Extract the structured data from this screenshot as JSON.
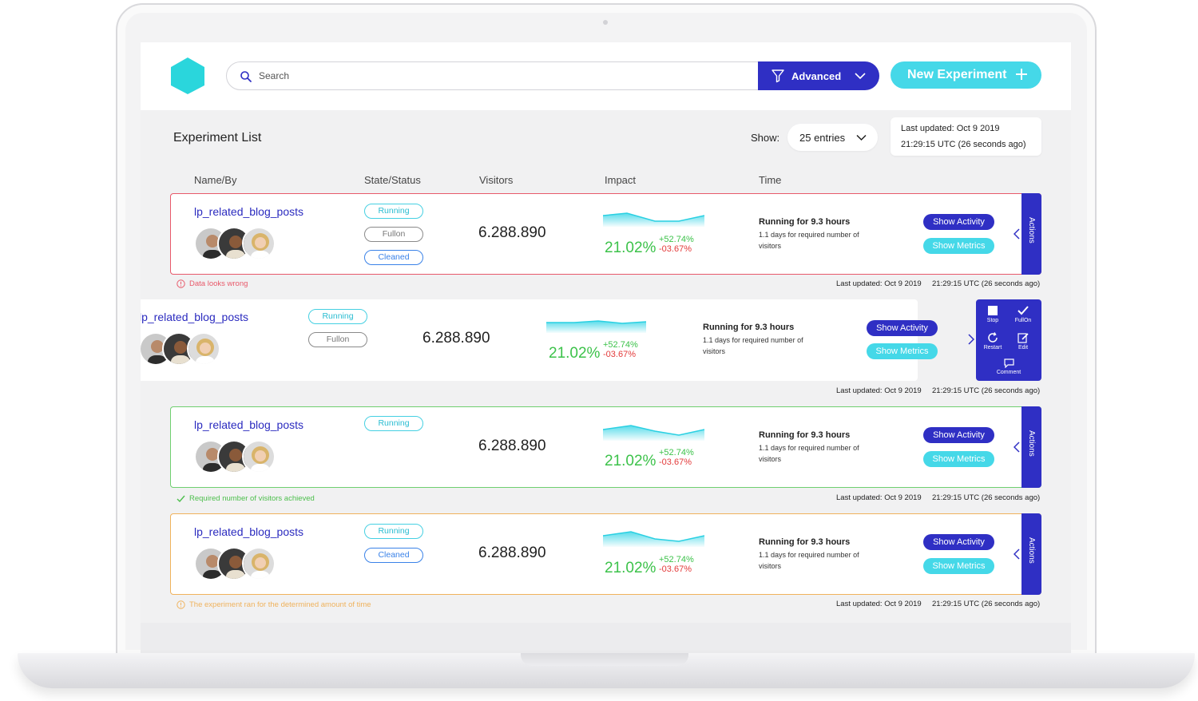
{
  "app": {
    "search_placeholder": "Search",
    "advanced_label": "Advanced",
    "new_experiment_label": "New Experiment"
  },
  "list": {
    "title": "Experiment List",
    "show_label": "Show:",
    "entries_value": "25 entries",
    "updated_line1": "Last updated: Oct 9 2019",
    "updated_line2": "21:29:15 UTC (26 seconds ago)"
  },
  "columns": [
    "Name/By",
    "State/Status",
    "Visitors",
    "Impact",
    "Time"
  ],
  "experiments": [
    {
      "name": "lp_related_blog_posts",
      "statuses": [
        "Running",
        "Fullon",
        "Cleaned"
      ],
      "visitors": "6.288.890",
      "impact": "21.02%",
      "impact_pos": "+52.74%",
      "impact_neg": "-03.67%",
      "time_title": "Running for 9.3 hours",
      "time_sub": "1.1 days for required number of visitors",
      "show_activity": "Show Activity",
      "show_metrics": "Show Metrics",
      "actions": "Actions",
      "footer_date": "Last updated: Oct 9 2019",
      "footer_time": "21:29:15 UTC (26 seconds ago)",
      "note": "Data looks wrong",
      "note_color": "#e8596a"
    },
    {
      "name": "lp_related_blog_posts",
      "statuses": [
        "Running",
        "Fullon"
      ],
      "visitors": "6.288.890",
      "impact": "21.02%",
      "impact_pos": "+52.74%",
      "impact_neg": "-03.67%",
      "time_title": "Running for 9.3 hours",
      "time_sub": "1.1 days for required number of visitors",
      "show_activity": "Show Activity",
      "show_metrics": "Show Metrics",
      "menu": {
        "stop": "Stop",
        "fullon": "FullOn",
        "restart": "Restart",
        "edit": "Edit",
        "comment": "Comment"
      },
      "footer_date": "Last updated: Oct 9 2019",
      "footer_time": "21:29:15 UTC (26 seconds ago)"
    },
    {
      "name": "lp_related_blog_posts",
      "statuses": [
        "Running"
      ],
      "visitors": "6.288.890",
      "impact": "21.02%",
      "impact_pos": "+52.74%",
      "impact_neg": "-03.67%",
      "time_title": "Running for 9.3 hours",
      "time_sub": "1.1 days for required number of visitors",
      "show_activity": "Show Activity",
      "show_metrics": "Show Metrics",
      "actions": "Actions",
      "footer_date": "Last updated: Oct 9 2019",
      "footer_time": "21:29:15 UTC (26 seconds ago)",
      "note": "Required number of visitors achieved",
      "note_color": "#4cbf4c"
    },
    {
      "name": "lp_related_blog_posts",
      "statuses": [
        "Running",
        "Cleaned"
      ],
      "visitors": "6.288.890",
      "impact": "21.02%",
      "impact_pos": "+52.74%",
      "impact_neg": "-03.67%",
      "time_title": "Running for 9.3 hours",
      "time_sub": "1.1 days for required number of visitors",
      "show_activity": "Show Activity",
      "show_metrics": "Show Metrics",
      "actions": "Actions",
      "footer_date": "Last updated: Oct 9 2019",
      "footer_time": "21:29:15 UTC (26 seconds ago)",
      "note": "The experiment ran for the determined amount of time",
      "note_color": "#f0b25c"
    }
  ],
  "colors": {
    "primary": "#2f2fc4",
    "accent": "#45d8e8",
    "positive": "#3cc24a",
    "negative": "#e33a3a"
  }
}
